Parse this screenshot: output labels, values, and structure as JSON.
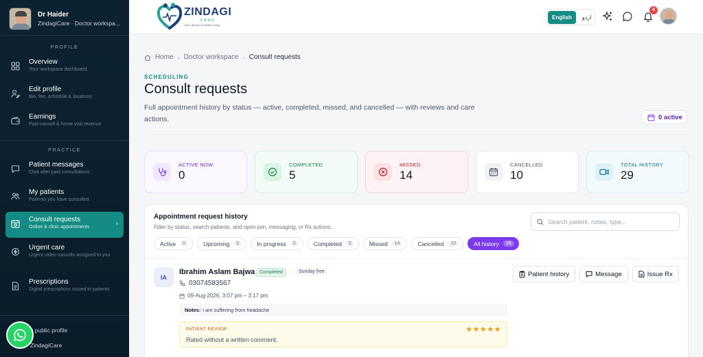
{
  "sidebar": {
    "profile": {
      "name": "Dr Haider",
      "subtitle": "ZindagiCare · Doctor workspa..."
    },
    "section_profile": "PROFILE",
    "section_practice": "PRACTICE",
    "items": [
      {
        "label": "Overview",
        "sub": "Your workspace dashboard"
      },
      {
        "label": "Edit profile",
        "sub": "Bio, fee, schedule & locations"
      },
      {
        "label": "Earnings",
        "sub": "Paid consult & home visit revenue"
      },
      {
        "label": "Patient messages",
        "sub": "Chat after paid consultations"
      },
      {
        "label": "My patients",
        "sub": "Patients you have consulted"
      },
      {
        "label": "Consult requests",
        "sub": "Online & clinic appointments"
      },
      {
        "label": "Urgent care",
        "sub": "Urgent video consults assigned to you"
      },
      {
        "label": "Prescriptions",
        "sub": "Digital prescriptions issued to patients"
      }
    ],
    "bottom_links": [
      "y public profile",
      "ZindagiCare"
    ]
  },
  "topbar": {
    "logo_name": "ZINDAGI",
    "logo_care": "CARE",
    "logo_tagline": "Care. Beyond to Better Living.",
    "lang_en": "English",
    "lang_ur": "اردو",
    "notification_count": "4"
  },
  "breadcrumb": [
    "Home",
    "Doctor workspace",
    "Consult requests"
  ],
  "header": {
    "eyebrow": "SCHEDULING",
    "title": "Consult requests",
    "description": "Full appointment history by status — active, completed, missed, and cancelled — with reviews and care actions.",
    "active_pill": "0 active"
  },
  "stats": [
    {
      "label": "ACTIVE NOW",
      "value": "0",
      "icon": "stethoscope-icon"
    },
    {
      "label": "COMPLETED",
      "value": "5",
      "icon": "check-circle-icon"
    },
    {
      "label": "MISSED",
      "value": "14",
      "icon": "x-circle-icon"
    },
    {
      "label": "CANCELLED",
      "value": "10",
      "icon": "calendar-icon"
    },
    {
      "label": "TOTAL HISTORY",
      "value": "29",
      "icon": "video-icon"
    }
  ],
  "history": {
    "title": "Appointment request history",
    "subtitle": "Filter by status, search patients, and open join, messaging, or Rx actions.",
    "search_placeholder": "Search patient, notes, type...",
    "filters": [
      {
        "label": "Active",
        "count": "0"
      },
      {
        "label": "Upcoming",
        "count": "0"
      },
      {
        "label": "In progress",
        "count": "0"
      },
      {
        "label": "Completed",
        "count": "5"
      },
      {
        "label": "Missed",
        "count": "14"
      },
      {
        "label": "Cancelled",
        "count": "10"
      },
      {
        "label": "All history",
        "count": "29"
      }
    ],
    "selected_filter": "All history",
    "row": {
      "initials": "IA",
      "name": "Ibrahim Aslam Bajwa",
      "status": "Completed",
      "tag": "Sunday free",
      "phone": "03074583567",
      "datetime": "09-Aug-2026, 3:07 pm – 3:17 pm",
      "notes_label": "Notes:",
      "notes": "i am suffering from headache",
      "review_title": "PATIENT REVIEW",
      "rating": "★★★★★",
      "rating_value": 5,
      "review_text": "Rated without a written comment.",
      "actions": [
        "Patient history",
        "Message",
        "Issue Rx"
      ]
    }
  },
  "colors": {
    "sidebar_bg": "#0d2231",
    "accent_teal": "#148b84",
    "accent_purple": "#7c3aed",
    "badge_red": "#e5484d",
    "whatsapp_green": "#25d366"
  }
}
